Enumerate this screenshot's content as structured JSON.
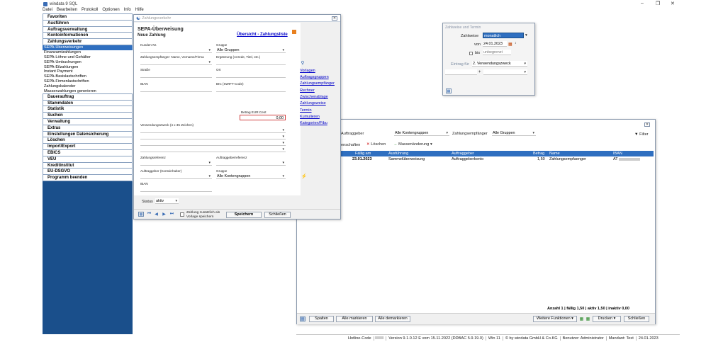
{
  "app": {
    "title": "windata 9 SQL"
  },
  "menu": [
    "Datei",
    "Bearbeiten",
    "Protokoll",
    "Optionen",
    "Info",
    "Hilfe"
  ],
  "sidebar": {
    "groups_top": [
      "Favoriten",
      "Ausführen",
      "Auftragsverwaltung",
      "Kontoinformationen",
      "Zahlungsverkehr"
    ],
    "sub_items": [
      "SEPA-Überweisungen",
      "Finanzamtzahlungen",
      "SEPA-Löhne und Gehälter",
      "SEPA-Umbuchungen",
      "SEPA-Eilzahlungen",
      "Instant Payment",
      "SEPA-Basislastschriften",
      "SEPA-Firmenlastschriften",
      "Zahlungskalender",
      "Massenzahlungen generieren"
    ],
    "groups_bottom": [
      "Dauerauftrag",
      "Stammdaten",
      "Statistik",
      "Suchen",
      "Verwaltung",
      "Extras",
      "Einstellungen Datensicherung",
      "Löschen",
      "Import/Export",
      "EBICS",
      "VEU",
      "Kreditinstitut",
      "EU-DSGVO",
      "Programm beenden"
    ]
  },
  "zahlung": {
    "title_bar": "Zahlungsverkehr",
    "heading": "SEPA-Überweisung",
    "subheading": "Neue Zahlung",
    "overview_link": "Übersicht - Zahlungsliste",
    "labels": {
      "kunden_nr": "Kunden-Nr.",
      "gruppe": "Gruppe",
      "empfaenger": "Zahlungsempfänger: Name, Vorname/Firma",
      "ergaenzung": "Ergänzung (Anrede, Titel, etc.)",
      "strasse": "Straße",
      "ort": "Ort",
      "iban": "IBAN",
      "bic": "BIC (SWIFT-Code)",
      "betrag": "Betrag EUR.Cent",
      "verwendung": "Verwendungszweck (4 x 35 Zeichen)",
      "zahlungsreferenz": "Zahlungsreferenz",
      "auftraggeberreferenz": "Auftraggeberreferenz",
      "auftraggeber": "Auftraggeber (Kontoinhaber)",
      "gruppe2": "Gruppe",
      "iban2": "IBAN",
      "status": "Status"
    },
    "values": {
      "gruppe": "Alle Gruppen",
      "betrag": "0,00",
      "gruppe2": "Alle Kontengruppen",
      "status": "aktiv"
    },
    "side_links": [
      "Vorlagen",
      "Auftragsgruppen",
      "Zahlungsempfänger",
      "Rechner",
      "Zwischenablage",
      "Zahlungsweise",
      "Termin",
      "Kumulieren",
      "Kategorien/Fibu"
    ],
    "checkbox_label_1": "Zahlung zusätzlich als",
    "checkbox_label_2": "Vorlage speichern",
    "save": "Speichern",
    "close": "Schließen"
  },
  "termin": {
    "title": "Zahlweise und Termin",
    "zahlweise_label": "Zahlweise",
    "zahlweise_value": "monatlich",
    "von_label": "von",
    "von_value": "24.01.2023",
    "bis_label": "bis",
    "bis_value": "unbegrenzt",
    "eintrag_label": "Eintrag für",
    "eintrag_value": "2. Verwendungszweck",
    "plus": "+"
  },
  "liste": {
    "auftraggeber_label": "Auftraggeber",
    "auftraggeber_value": "Alle Kontengruppen",
    "empfaenger_label": "Zahlungsempfänger",
    "empfaenger_value": "Alle Gruppen",
    "filter": "Filter",
    "eigenschaften": "enschaften",
    "loeschen": "Löschen",
    "massenaenderung": "Massenänderung",
    "columns": [
      "Fällig am",
      "Ausführung",
      "Auftraggeber",
      "Betrag",
      "Name",
      "IBAN"
    ],
    "row": {
      "faellig": "23.01.2023",
      "ausfuehrung": "Sammelüberweisung",
      "auftraggeber": "Auftraggeberkonto",
      "betrag": "1,50",
      "name": "Zahlungsempfaenger",
      "iban": "AT"
    },
    "summary": "Anzahl 1 | fällig 1,50 | aktiv 1,50 | inaktiv 0,00",
    "spalten": "Spalten",
    "alle_markieren": "Alle markieren",
    "alle_demarkieren": "Alle demarkieren",
    "weitere": "Weitere Funktionen",
    "drucken": "Drucken",
    "schliessen": "Schließen"
  },
  "statusbar": {
    "hotline": "Hotline-Code",
    "version": "Version 9.1.0.12 E vom 15.11.2022 (DDBAC 5.9.19.0)",
    "win": "Win 11",
    "copyright": "© by windata GmbH & Co.KG",
    "benutzer": "Benutzer: Administrator",
    "mandant": "Mandant: Test",
    "date": "24.01.2023"
  },
  "colors": {
    "sidebar": "#1a4f8b",
    "selection": "#2f6fc0",
    "link": "#0000c8",
    "accent": "#e8801f"
  }
}
